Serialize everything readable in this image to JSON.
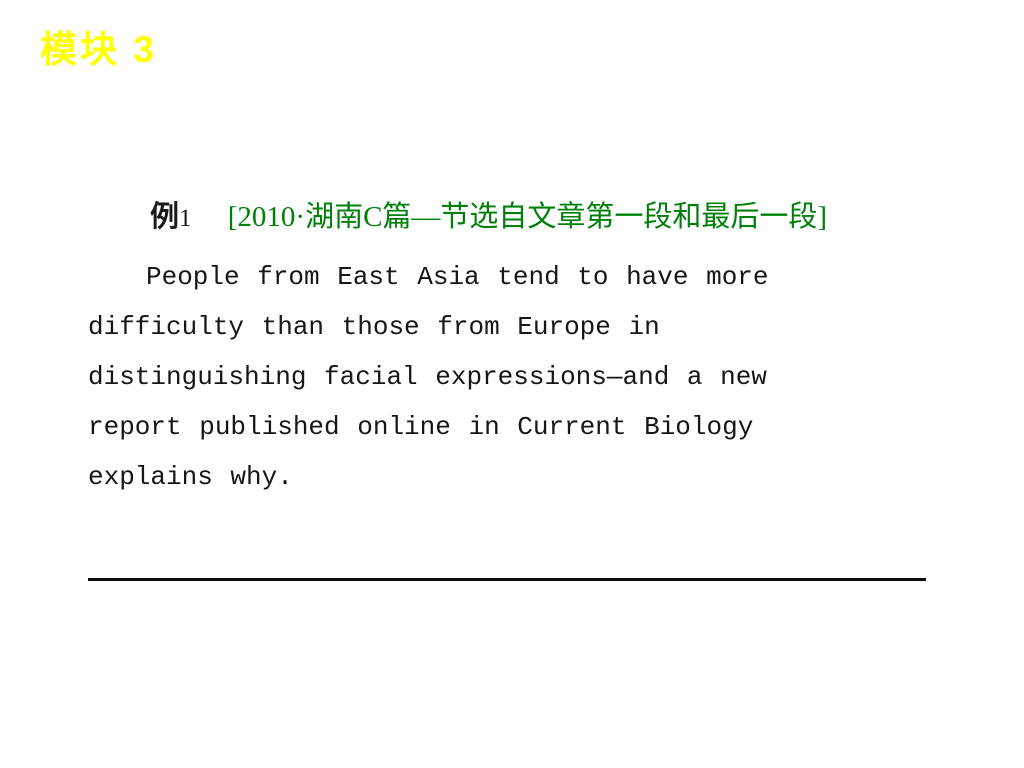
{
  "slide": {
    "background_color": "#ffffff",
    "module_title": "模块 3",
    "module_title_color": "#ffff00"
  },
  "example": {
    "label": "例",
    "ordinal": "1",
    "gap": "   ",
    "source_tag": "[2010·湖南C篇—节选自文章第一段和最后一段]",
    "source_color": "#00800a",
    "label_color": "#1a1a1a"
  },
  "passage": {
    "text": "People from East Asia tend to have more difficulty than those from Europe in distinguishing facial expressions—and a new report published online in Current Biology explains why.",
    "lines": [
      "People from East Asia tend to have more",
      "difficulty than those from Europe in",
      "distinguishing facial expressions—and a new",
      "report published online in Current Biology",
      "explains why."
    ],
    "color": "#161616"
  },
  "divider": {
    "color": "#0d0d0d",
    "thickness": "3px"
  }
}
